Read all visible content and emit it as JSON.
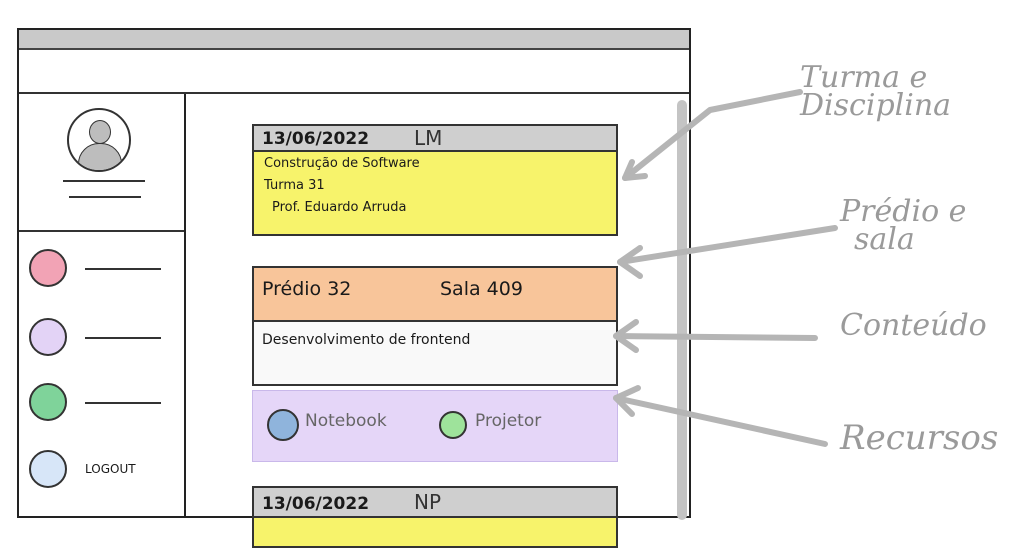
{
  "sidebar": {
    "items": [
      {
        "color": "#f2a3b5"
      },
      {
        "color": "#e3d3f6"
      },
      {
        "color": "#7fd39a"
      },
      {
        "color": "#d7e6f8",
        "label": "LOGOUT"
      }
    ]
  },
  "cards": [
    {
      "date": "13/06/2022",
      "code": "LM",
      "course": "Construção de Software",
      "turma": "Turma 31",
      "professor": "Prof. Eduardo Arruda",
      "building": "Prédio 32",
      "room": "Sala 409",
      "content": "Desenvolvimento de frontend",
      "resources": [
        {
          "name": "Notebook",
          "color": "#8fb4dc"
        },
        {
          "name": "Projetor",
          "color": "#9ee39b"
        }
      ]
    },
    {
      "date": "13/06/2022",
      "code": "NP"
    }
  ],
  "annotations": {
    "turma": [
      "Turma e",
      "Disciplina"
    ],
    "predio": [
      "Prédio e",
      "sala"
    ],
    "conteudo": "Conteúdo",
    "recursos": "Recursos"
  },
  "colors": {
    "yellow": "#f7f36b",
    "orange": "#f8c59a",
    "purple": "#e5d6f8",
    "annotation": "#9a9a9a"
  }
}
